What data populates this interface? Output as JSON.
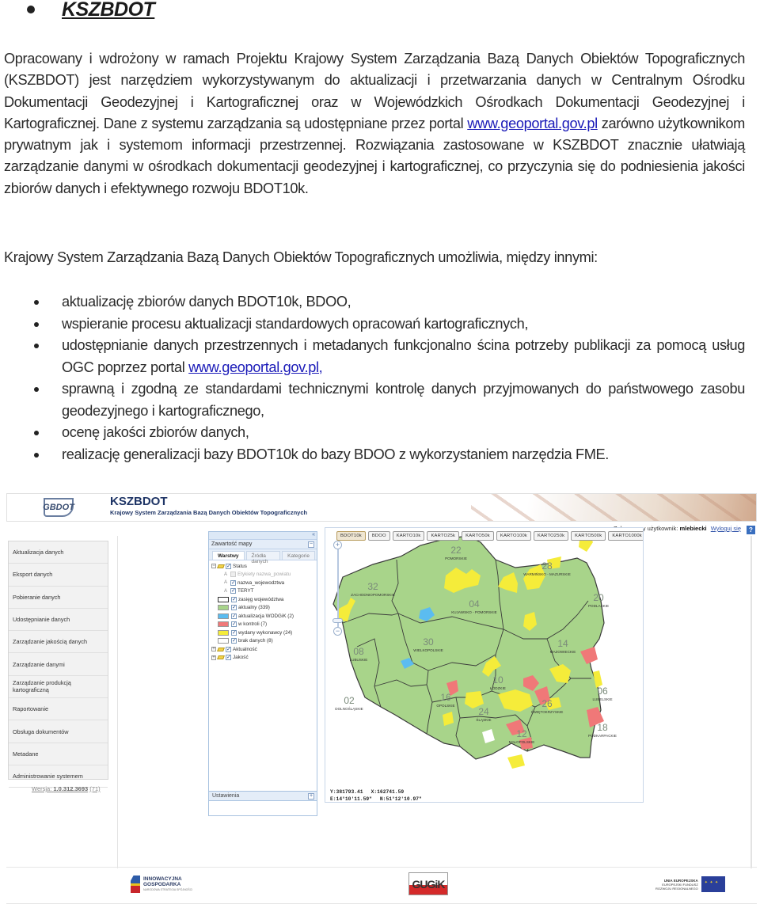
{
  "heading": "KSZBDOT",
  "paragraph1": {
    "before_link": "Opracowany i wdrożony w ramach Projektu Krajowy System Zarządzania Bazą Danych Obiektów Topograficznych (KSZBDOT) jest narzędziem wykorzystywanym do aktualizacji i przetwarzania danych w Centralnym Ośrodku Dokumentacji Geodezyjnej i Kartograficznej oraz w Wojewódzkich Ośrodkach Dokumentacji Geodezyjnej i Kartograficznej. Dane z systemu zarządzania są udostępniane przez portal ",
    "link": "www.geoportal.gov.pl",
    "after_link": " zarówno użytkownikom prywatnym jak i systemom informacji przestrzennej. Rozwiązania zastosowane w KSZBDOT znacznie ułatwiają zarządzanie danymi w ośrodkach dokumentacji geodezyjnej i kartograficznej, co przyczynia się do  podniesienia jakości zbiorów danych i efektywnego rozwoju BDOT10k."
  },
  "paragraph2": "Krajowy System Zarządzania Bazą Danych Obiektów Topograficznych umożliwia, między innymi:",
  "bullets": [
    {
      "text": "aktualizację zbiorów danych BDOT10k, BDOO,"
    },
    {
      "text": "wspieranie procesu aktualizacji standardowych opracowań kartograficznych,"
    },
    {
      "text": "udostępnianie danych przestrzennych i metadanych funkcjonalno ścina potrzeby publikacji za pomocą usług OGC poprzez portal ",
      "link": "www.geoportal.gov.pl,"
    },
    {
      "text": "sprawną i zgodną ze standardami technicznymi kontrolę danych przyjmowanych do państwowego zasobu geodezyjnego i kartograficznego,"
    },
    {
      "text": "ocenę jakości zbiorów danych,"
    },
    {
      "text": "realizację generalizacji bazy BDOT10k do bazy BDOO z wykorzystaniem narzędzia FME."
    }
  ],
  "app": {
    "logo_text": "GBDOT",
    "title": "KSZBDOT",
    "subtitle": "Krajowy System Zarządzania Bazą Danych Obiektów Topograficznych",
    "user_label": "Zalogowany użytkownik:",
    "username": "mlebiecki",
    "logout": "Wyloguj się",
    "help": "?",
    "nav": [
      "Aktualizacja danych",
      "Eksport danych",
      "Pobieranie danych",
      "Udostępnianie danych",
      "Zarządzanie jakością danych",
      "Zarządzanie danymi",
      "Zarządzanie produkcją kartograficzną",
      "Raportowanie",
      "Obsługa dokumentów",
      "Metadane",
      "Administrowanie systemem"
    ],
    "version_label": "Wersja:",
    "version": "1.0.312.3693",
    "version_extra": "(71)",
    "layers_panel": {
      "collapse_icon": "«",
      "title": "Zawartość mapy",
      "minimize": "−",
      "tabs": [
        "Warstwy",
        "Źródła danych",
        "Kategorie"
      ],
      "tree": {
        "status": "Status",
        "labels_powiat": "Etykiety nazwa_powiatu",
        "labels_woj": "nazwa_wojewodztwa",
        "teryt": "TERYT",
        "zasieg": "zasięg województwa",
        "legend": [
          {
            "label": "aktualny (339)",
            "color": "#a8d48a"
          },
          {
            "label": "aktualizacja WODGiK (2)",
            "color": "#5bbcf0"
          },
          {
            "label": "w kontroli (7)",
            "color": "#f07878"
          },
          {
            "label": "wydany wykonawcy (24)",
            "color": "#f5ec3a"
          },
          {
            "label": "brak danych (8)",
            "color": "#ffffff"
          }
        ],
        "aktualnosc": "Aktualność",
        "jakosc": "Jakość"
      },
      "settings": "Ustawienia",
      "settings_plus": "+"
    },
    "map": {
      "tabs": [
        "BDOT10k",
        "BDOO",
        "KARTO10k",
        "KARTO25k",
        "KARTO50k",
        "KARTO100k",
        "KARTO250k",
        "KARTO500k",
        "KARTO1000k"
      ],
      "active_tab": 0,
      "zoom_in": "+",
      "zoom_out": "−",
      "regions": [
        {
          "code": "32",
          "name": "ZACHODNIOPOMORSKIE"
        },
        {
          "code": "22",
          "name": "POMORSKIE"
        },
        {
          "code": "28",
          "name": "WARMIŃSKO - MAZURSKIE"
        },
        {
          "code": "20",
          "name": "PODLASKIE"
        },
        {
          "code": "04",
          "name": "KUJAWSKO - POMORSKIE"
        },
        {
          "code": "30",
          "name": "WIELKOPOLSKIE"
        },
        {
          "code": "08",
          "name": "LUBUSKIE"
        },
        {
          "code": "14",
          "name": "MAZOWIECKIE"
        },
        {
          "code": "10",
          "name": "ŁÓDZKIE"
        },
        {
          "code": "02",
          "name": "DOLNOŚLĄSKIE"
        },
        {
          "code": "16",
          "name": "OPOLSKIE"
        },
        {
          "code": "24",
          "name": "ŚLĄSKIE"
        },
        {
          "code": "26",
          "name": "ŚWIĘTOKRZYSKIE"
        },
        {
          "code": "06",
          "name": "LUBELSKIE"
        },
        {
          "code": "12",
          "name": "MAŁOPOLSKIE"
        },
        {
          "code": "18",
          "name": "PODKARPACKIE"
        }
      ],
      "coords": {
        "y": "Y:381793.41",
        "x": "X:162741.59",
        "e": "E:14°10'11.59\"",
        "n": "N:51°12'10.97\""
      }
    },
    "footer": {
      "ig_title": "INNOWACYJNA",
      "ig_title2": "GOSPODARKA",
      "ig_sub": "NARODOWA STRATEGIA SPÓJNOŚCI",
      "gugik": "GUGiK",
      "ue_title": "UNIA EUROPEJSKA",
      "ue_line2": "EUROPEJSKI FUNDUSZ",
      "ue_line3": "ROZWOJU REGIONALNEGO"
    }
  }
}
